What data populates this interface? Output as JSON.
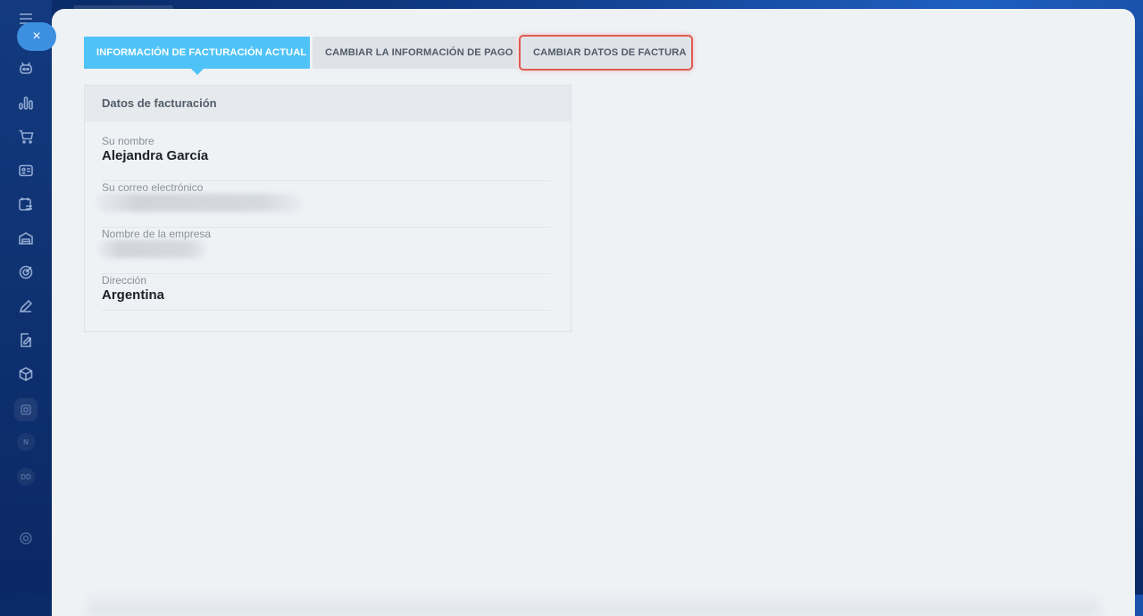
{
  "tabs": {
    "current": "INFORMACIÓN DE FACTURACIÓN ACTUAL",
    "payment": "CAMBIAR LA INFORMACIÓN DE PAGO",
    "invoice": "CAMBIAR DATOS DE FACTURA"
  },
  "card": {
    "title": "Datos de facturación",
    "fields": [
      {
        "label": "Su nombre",
        "value": "Alejandra García"
      },
      {
        "label": "Su correo electrónico",
        "value": ""
      },
      {
        "label": "Nombre de la empresa",
        "value": ""
      },
      {
        "label": "Dirección",
        "value": "Argentina"
      }
    ]
  },
  "close_symbol": "×",
  "sidebar_badges": [
    "N",
    "DD"
  ],
  "colors": {
    "active_tab": "#4fc3f7",
    "highlight": "#e05a50",
    "panel": "#eef2f5",
    "close_button": "#3d8fe0"
  }
}
